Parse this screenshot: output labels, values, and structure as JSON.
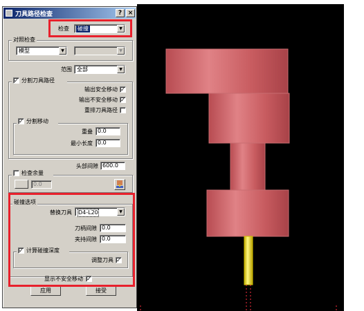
{
  "dialog": {
    "title": "刀具路径检查",
    "help_label": "?",
    "close_label": "×",
    "check_label": "检查",
    "check_value": "碰撞",
    "reference_group": "对照检查",
    "reference_value": "模型",
    "scope_label": "范围",
    "scope_value": "全部",
    "split_toolpath_label": "分割刀具路径",
    "output_safe_moves": "输出安全移动",
    "output_unsafe_moves": "输出不安全移动",
    "reorder_toolpath": "重排刀具路径",
    "split_moves_label": "分割移动",
    "overlap_label": "重叠",
    "overlap_value": "0.0",
    "min_length_label": "最小长度",
    "min_length_value": "0.0",
    "head_clearance_label": "头部间隙",
    "head_clearance_value": "600.0",
    "check_stock_label": "检查余量",
    "stock_value": "0.0",
    "collision_options_label": "碰撞选项",
    "replace_tool_label": "替换刀具",
    "replace_tool_value": "D4-L20",
    "shank_clearance_label": "刀柄间隙",
    "shank_clearance_value": "0.0",
    "holder_clearance_label": "夹持间隙",
    "holder_clearance_value": "0.0",
    "calc_collision_depth_label": "计算碰撞深度",
    "adjust_tool_label": "调整刀具",
    "show_unsafe_moves_label": "显示不安全移动",
    "apply_button": "应用",
    "accept_button": "接受",
    "checkmark": "✓"
  },
  "colors": {
    "titlebar": "#0a246a",
    "dialog_bg": "#d4d0c8",
    "highlight_box": "#e8202c",
    "holder_body": "#c85c60",
    "tool_tip": "#e6e000",
    "viewport_bg": "#000000"
  }
}
